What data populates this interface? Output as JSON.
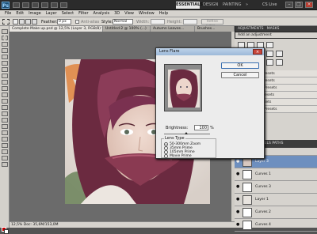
{
  "titlebar": {
    "logo": "Ps",
    "workspaces": [
      "ESSENTIALS",
      "DESIGN",
      "PAINTING",
      "»"
    ],
    "cs_live": "CS Live",
    "window_buttons": [
      "–",
      "□",
      "×"
    ]
  },
  "menu": [
    "File",
    "Edit",
    "Image",
    "Layer",
    "Select",
    "Filter",
    "Analysis",
    "3D",
    "View",
    "Window",
    "Help"
  ],
  "options_bar": {
    "feather_label": "Feather:",
    "feather_value": "0 px",
    "antialias_label": "Anti-alias",
    "style_label": "Style:",
    "style_value": "Normal",
    "width_label": "Width:",
    "height_label": "Height:",
    "refine_edge_label": "Refine Edge..."
  },
  "tabs": [
    {
      "label": "Complete Make up.psd @ 12,5% (Layer 3, RGB/8) *",
      "active": true
    },
    {
      "label": "Untitled-2 @ 100% (...)",
      "active": false
    },
    {
      "label": "Autumn Leaves...",
      "active": false
    },
    {
      "label": "Brushes...",
      "active": false
    }
  ],
  "status_bar": "12,5%   Doc: 35,6M/153,0M",
  "panels": {
    "adjustments_tab": "ADJUSTMENTS",
    "masks_tab": "MASKS",
    "add_adjustment": "Add an adjustment",
    "presets": [
      "n Presets",
      "n Presets",
      "on Presets",
      "s Presets",
      "Presets",
      "on Presets"
    ],
    "layers_tabs": "LAYERS  CHANNELS  PATHS",
    "layers": [
      {
        "name": "Layer 3",
        "selected": true
      },
      {
        "name": "Curves 1",
        "selected": false
      },
      {
        "name": "Curves 3",
        "selected": false
      },
      {
        "name": "Layer 1",
        "selected": false
      },
      {
        "name": "Curves 2",
        "selected": false
      },
      {
        "name": "Curves 4",
        "selected": false
      }
    ]
  },
  "dialog": {
    "title": "Lens Flare",
    "close": "×",
    "ok": "OK",
    "cancel": "Cancel",
    "brightness_label": "Brightness:",
    "brightness_value": "100",
    "brightness_unit": "%",
    "lens_type_label": "Lens Type",
    "lens_types": [
      {
        "label": "50-300mm Zoom",
        "selected": true
      },
      {
        "label": "35mm Prime",
        "selected": false
      },
      {
        "label": "105mm Prime",
        "selected": false
      },
      {
        "label": "Movie Prime",
        "selected": false
      }
    ]
  },
  "colors": {
    "foreground": "#c40000",
    "background": "#ffffff",
    "accent_selection": "#6d8fbf"
  }
}
